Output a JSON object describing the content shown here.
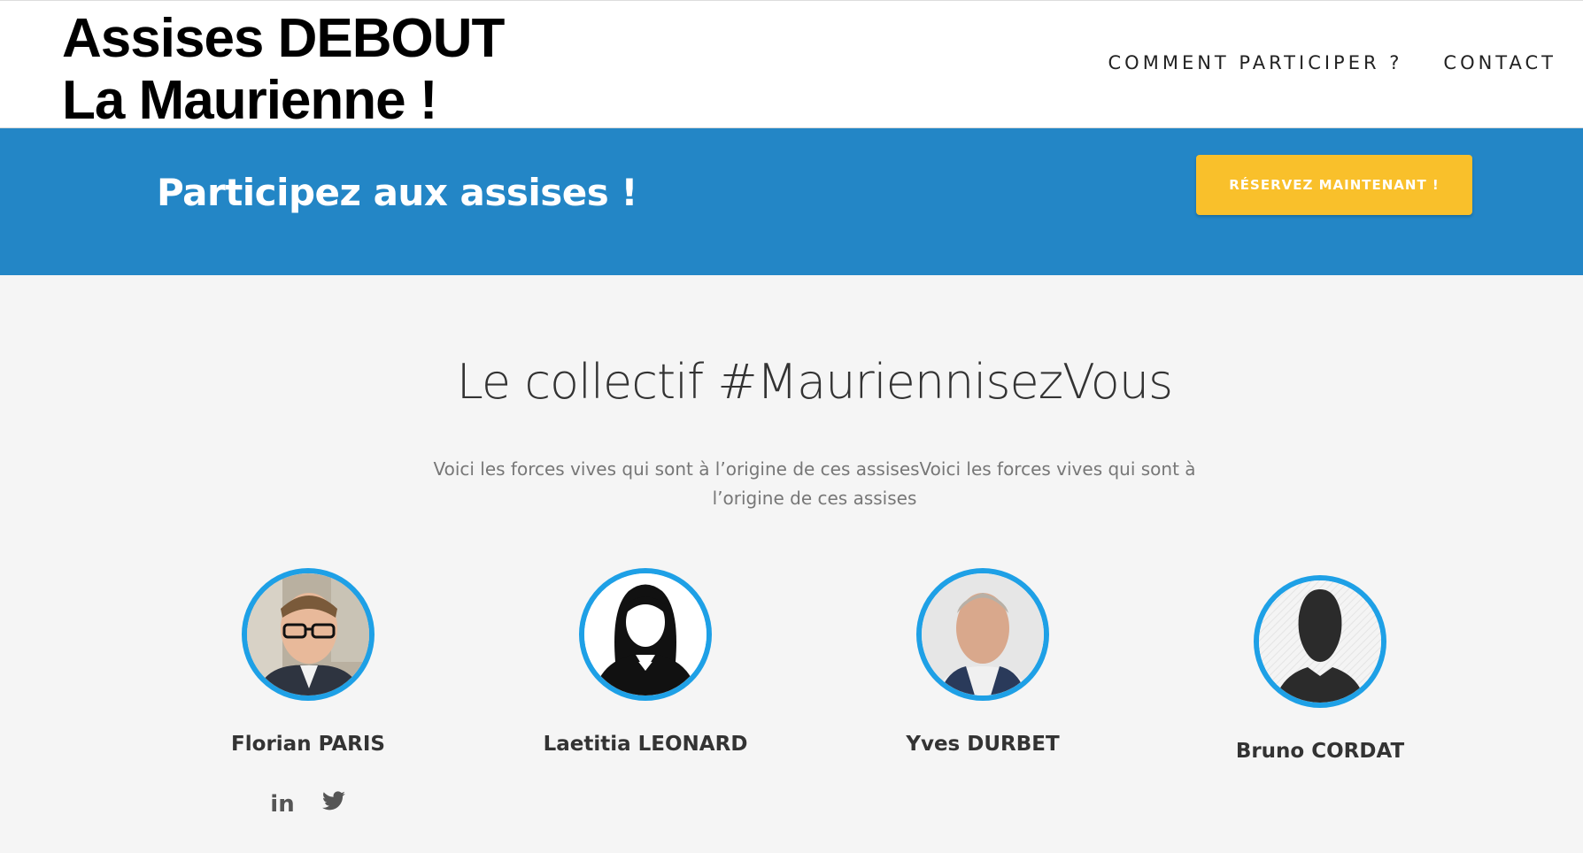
{
  "header": {
    "logo_line1": "Assises DEBOUT",
    "logo_line2": "La Maurienne !",
    "nav": [
      "COMMENT PARTICIPER ?",
      "CONTACT"
    ]
  },
  "banner": {
    "title": "Participez aux assises !",
    "cta_label": "RÉSERVEZ MAINTENANT !",
    "bg_color": "#2386c6",
    "cta_color": "#f9c02b"
  },
  "section": {
    "title": "Le collectif #MauriennisezVous",
    "subtitle": "Voici les forces vives qui sont à l’origine de ces assisesVoici les forces vives qui sont à l’origine de ces assises"
  },
  "members": [
    {
      "name": "Florian PARIS",
      "photo": "photo"
    },
    {
      "name": "Laetitia LEONARD",
      "photo": "female-silhouette"
    },
    {
      "name": "Yves DURBET",
      "photo": "photo"
    },
    {
      "name": "Bruno CORDAT",
      "photo": "male-silhouette"
    }
  ],
  "socials": [
    "linkedin-icon",
    "twitter-icon"
  ],
  "accent_color": "#1ea0e6"
}
